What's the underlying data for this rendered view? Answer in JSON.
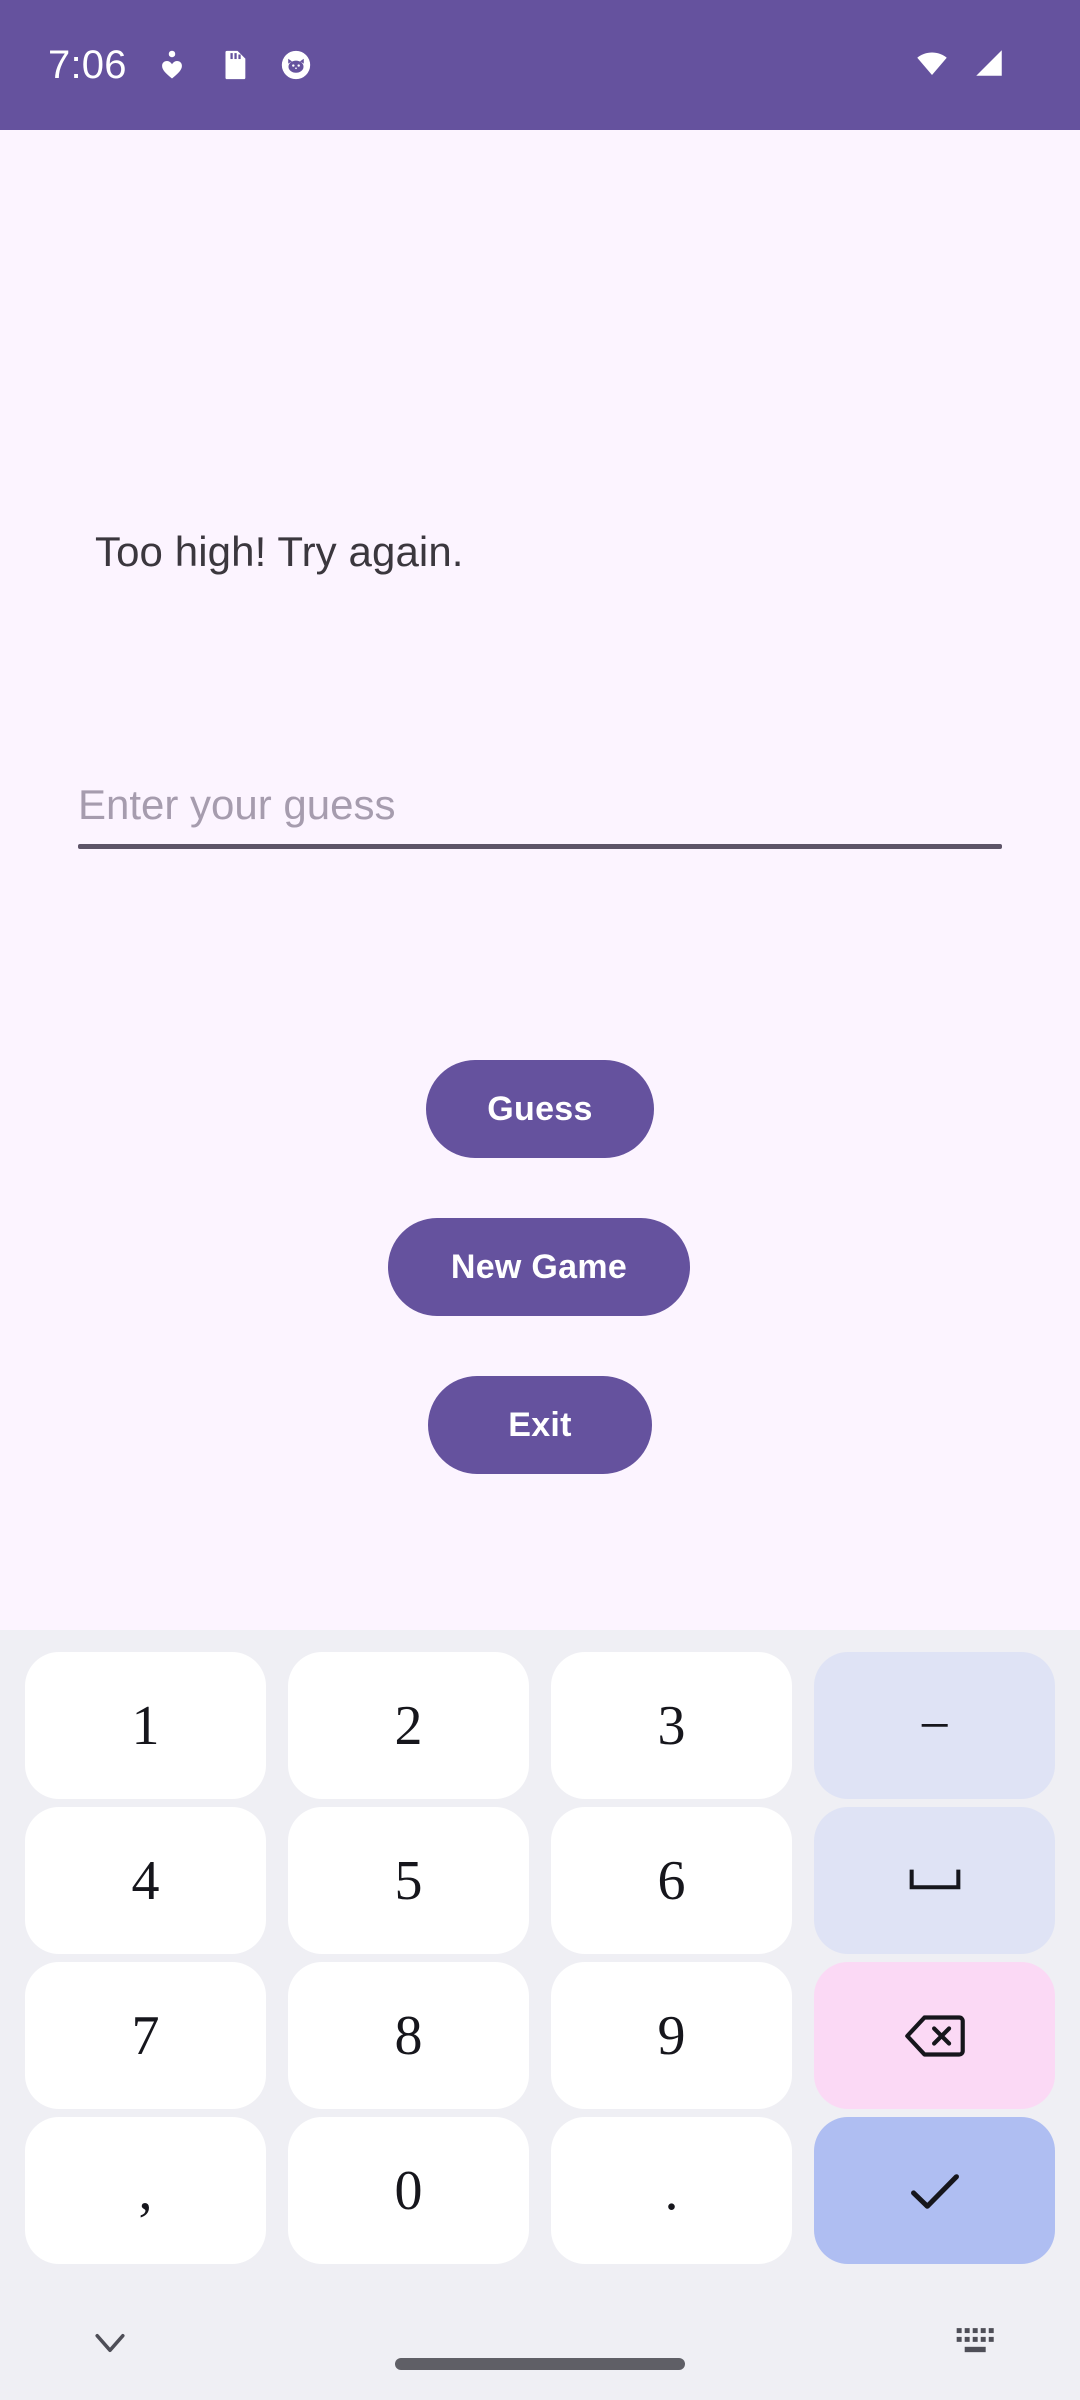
{
  "status_bar": {
    "time": "7:06",
    "bg_color": "#65529E",
    "left_icons": [
      {
        "name": "heart-person-icon",
        "glyph": "health"
      },
      {
        "name": "sd-card-icon",
        "glyph": "sdcard"
      },
      {
        "name": "cat-face-icon",
        "glyph": "cat"
      }
    ],
    "right_icons": [
      {
        "name": "wifi-icon",
        "glyph": "wifi"
      },
      {
        "name": "cellular-signal-icon",
        "glyph": "signal"
      }
    ]
  },
  "app": {
    "background_color": "#FCF4FF",
    "accent_color": "#65529E",
    "result_message": "Too high! Try again.",
    "input": {
      "placeholder": "Enter your guess",
      "value": "",
      "underline_color": "#5D5468"
    },
    "buttons": {
      "guess_label": "Guess",
      "new_game_label": "New Game",
      "exit_label": "Exit"
    }
  },
  "keyboard": {
    "background_color": "#EFEFF4",
    "key_color": "#FFFFFF",
    "function_key_color": "#DFE3F5",
    "delete_key_color": "#FBD9F5",
    "enter_key_color": "#AFBEF2",
    "rows": [
      [
        {
          "name": "key-1",
          "label": "1",
          "type": "num"
        },
        {
          "name": "key-2",
          "label": "2",
          "type": "num"
        },
        {
          "name": "key-3",
          "label": "3",
          "type": "num"
        },
        {
          "name": "key-minus",
          "label": "−",
          "type": "fn"
        }
      ],
      [
        {
          "name": "key-4",
          "label": "4",
          "type": "num"
        },
        {
          "name": "key-5",
          "label": "5",
          "type": "num"
        },
        {
          "name": "key-6",
          "label": "6",
          "type": "num"
        },
        {
          "name": "key-space",
          "label": "␣",
          "type": "fn"
        }
      ],
      [
        {
          "name": "key-7",
          "label": "7",
          "type": "num"
        },
        {
          "name": "key-8",
          "label": "8",
          "type": "num"
        },
        {
          "name": "key-9",
          "label": "9",
          "type": "num"
        },
        {
          "name": "key-backspace",
          "label": "backspace-icon",
          "type": "del"
        }
      ],
      [
        {
          "name": "key-comma",
          "label": ",",
          "type": "num"
        },
        {
          "name": "key-0",
          "label": "0",
          "type": "num"
        },
        {
          "name": "key-period",
          "label": ".",
          "type": "num"
        },
        {
          "name": "key-enter",
          "label": "checkmark-icon",
          "type": "ok"
        }
      ]
    ]
  },
  "nav_bar": {
    "background_color": "#EFEFF4",
    "back_icon": "chevron-down-icon",
    "home_indicator": "home-pill",
    "keyboard_switch_icon": "keyboard-icon"
  }
}
